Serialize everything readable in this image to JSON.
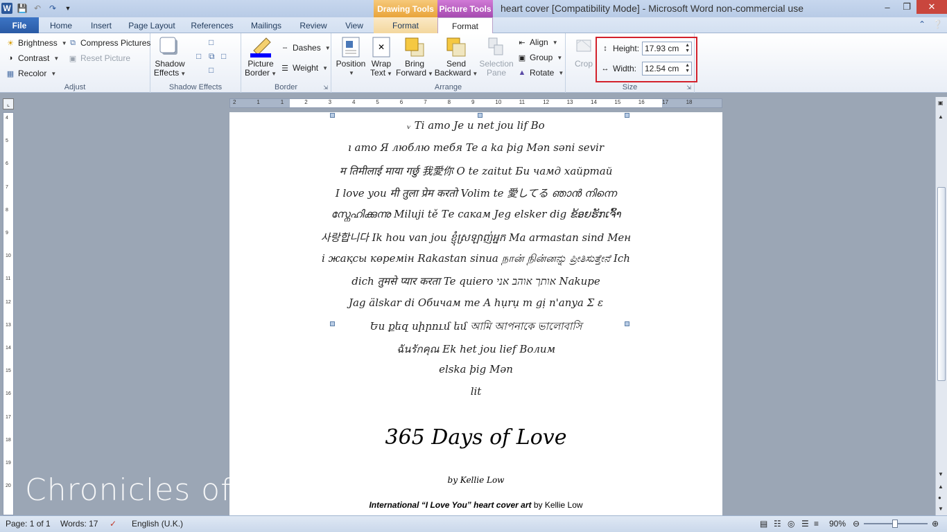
{
  "window": {
    "title": "heart cover [Compatibility Mode]  -  Microsoft Word non-commercial use",
    "context_drawing": "Drawing Tools",
    "context_picture": "Picture Tools"
  },
  "tabs": {
    "file": "File",
    "home": "Home",
    "insert": "Insert",
    "page_layout": "Page Layout",
    "references": "References",
    "mailings": "Mailings",
    "review": "Review",
    "view": "View",
    "drawing_format": "Format",
    "picture_format": "Format"
  },
  "ribbon": {
    "adjust": {
      "label": "Adjust",
      "brightness": "Brightness",
      "contrast": "Contrast",
      "recolor": "Recolor",
      "compress": "Compress Pictures",
      "reset": "Reset Picture"
    },
    "shadow": {
      "label": "Shadow Effects",
      "button_line1": "Shadow",
      "button_line2": "Effects"
    },
    "border": {
      "label": "Border",
      "picture_border_1": "Picture",
      "picture_border_2": "Border",
      "dashes": "Dashes",
      "weight": "Weight",
      "border_color": "#0000ff"
    },
    "arrange": {
      "label": "Arrange",
      "position": "Position",
      "wrap_1": "Wrap",
      "wrap_2": "Text",
      "bring_1": "Bring",
      "bring_2": "Forward",
      "send_1": "Send",
      "send_2": "Backward",
      "selection_1": "Selection",
      "selection_2": "Pane",
      "align": "Align",
      "group": "Group",
      "rotate": "Rotate"
    },
    "crop": "Crop",
    "size": {
      "label": "Size",
      "height_label": "Height:",
      "height_value": "17.93 cm",
      "width_label": "Width:",
      "width_value": "12.54 cm"
    }
  },
  "ruler": {
    "h_ticks": [
      "2",
      "1",
      "1",
      "2",
      "3",
      "4",
      "5",
      "6",
      "7",
      "8",
      "9",
      "10",
      "11",
      "12",
      "13",
      "14",
      "15",
      "16",
      "17",
      "18"
    ],
    "v_ticks": [
      "4",
      "5",
      "6",
      "7",
      "8",
      "9",
      "10",
      "11",
      "12",
      "13",
      "14",
      "15",
      "16",
      "17",
      "18",
      "19",
      "20"
    ]
  },
  "document": {
    "heart_lines": [
      "ᵥ Ti amo  Je u                        net jou lif  Bo",
      "ı amo  Я люблю тебя  Te a                  ka þig    Mən səni sevir",
      "म तिमीलाई माया गर्छु   我愛你   O   te zaitut   Би чамд хайртай",
      "I love you  मी तुला प्रेम करतो  Volim te  愛してる  ഞാൻ നിന്നെ",
      "സ്നേഹിക്കുന്നു  Miluji tě  Те сакам  Jeg elsker dig  ຂ້ອຍຮັກເຈົ້າ",
      "사랑합니다  Ik hou van jou  ខ្ញុំស្រឡាញ់អ្នក  Ma armastan sind  Мен",
      "і жақсы көремін  Rakastan sinua  நான் நின்னನ್ನು ಪ್ರೀತಿಸುತ್ತೇನೆ  Ich",
      "dich  तुमसे प्यार करता  Te quiero  אותך אוהב אני  Nakupe",
      "Jag älskar di  Обичам те  A hụrụ m gị n'anya  Σ ε",
      "Ես քեզ սիրում եմ     আমি আপনাকে ভালোবাসি",
      "ฉันรักคุณ  Ek het jou lief  Волим",
      "  elska þig    Mən",
      "lit"
    ],
    "title": "365 Days of Love",
    "author": "by Kellie Low",
    "caption_bold": "International  “I Love You” heart cover art",
    "caption_rest": " by Kellie Low"
  },
  "watermark": "Chronicles of Chean",
  "status": {
    "page": "Page: 1 of 1",
    "words": "Words: 17",
    "language": "English (U.K.)",
    "zoom": "90%"
  }
}
